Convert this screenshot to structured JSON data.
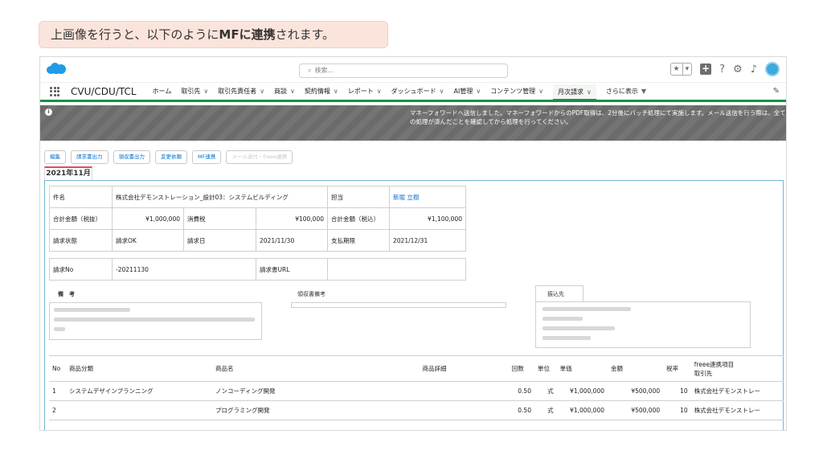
{
  "caption": {
    "pre": "上画像を行うと、以下のように",
    "bold": "MFに連携",
    "post": "されます。"
  },
  "header": {
    "search_placeholder": "検索...",
    "icons": [
      "salesforce-cloud-icon",
      "search-icon",
      "star-icon",
      "chevron-down-icon",
      "plus-icon",
      "help-icon",
      "gear-icon",
      "bell-icon",
      "avatar"
    ]
  },
  "nav": {
    "app_name": "CVU/CDU/TCL",
    "items": [
      {
        "label": "ホーム",
        "chevron": ""
      },
      {
        "label": "取引先",
        "chevron": "∨"
      },
      {
        "label": "取引先責任者",
        "chevron": "∨"
      },
      {
        "label": "商談",
        "chevron": "∨"
      },
      {
        "label": "契約情報",
        "chevron": "∨"
      },
      {
        "label": "レポート",
        "chevron": "∨"
      },
      {
        "label": "ダッシュボード",
        "chevron": "∨"
      },
      {
        "label": "AI管理",
        "chevron": "∨"
      },
      {
        "label": "コンテンツ管理",
        "chevron": "∨"
      },
      {
        "label": "月次請求",
        "chevron": "∨"
      },
      {
        "label": "さらに表示",
        "chevron": "▼"
      }
    ],
    "active_index": 9
  },
  "banner": {
    "message": "マネーフォワードへ送信しました。マネーフォワードからのPDF取得は、2分後にバッチ処理にて実施します。メール送信を行う際は、全ての処理が済んだことを確認してから処理を行ってください。"
  },
  "actions": [
    "編集",
    "請求書出力",
    "領収書出力",
    "変更依頼",
    "MF連携",
    "メール送付・freee連携"
  ],
  "tab_label": "2021年11月",
  "info": {
    "subject_label": "件名",
    "subject": "株式会社デモンストレーション_設計03：システムビルディング",
    "owner_label": "担当",
    "owner": "新堀 立樹",
    "subtotal_label": "合計金額（税抜）",
    "subtotal": "¥1,000,000",
    "tax_label": "消費税",
    "tax": "¥100,000",
    "total_label": "合計金額（税込）",
    "total": "¥1,100,000",
    "status_label": "請求状態",
    "status": "請求OK",
    "bill_date_label": "請求日",
    "bill_date": "2021/11/30",
    "due_label": "支払期限",
    "due": "2021/12/31",
    "billno_label": "請求No",
    "billno": "-20211130",
    "url_label": "請求書URL",
    "url": ""
  },
  "notes": {
    "remarks_label": "備　考",
    "receipt_label": "領収書備考",
    "bank_label": "振込先"
  },
  "items": {
    "headers": [
      "No",
      "商品分類",
      "商品名",
      "商品詳細",
      "回数",
      "単位",
      "単価",
      "金額",
      "税率",
      "freee連携項目\n取引先"
    ],
    "rows": [
      [
        "1",
        "システムデザインプランニング",
        "ノンコーディング開発",
        "",
        "0.50",
        "式",
        "¥1,000,000",
        "¥500,000",
        "10",
        "株式会社デモンストレー"
      ],
      [
        "2",
        "",
        "プログラミング開発",
        "",
        "0.50",
        "式",
        "¥1,000,000",
        "¥500,000",
        "10",
        "株式会社デモンストレー"
      ]
    ]
  }
}
